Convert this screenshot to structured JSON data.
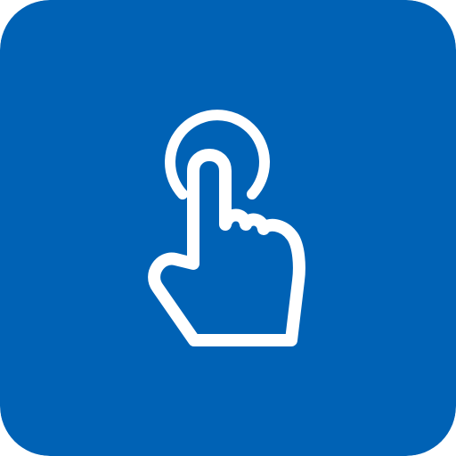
{
  "icon": {
    "name": "tap-gesture-icon",
    "background_color": "#0062B5",
    "glyph_color": "#FFFFFF"
  }
}
